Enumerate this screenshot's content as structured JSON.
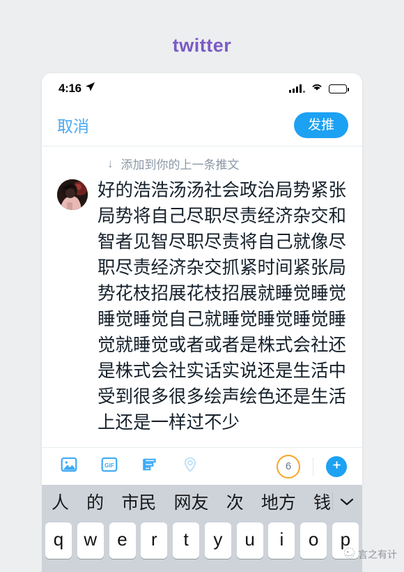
{
  "page": {
    "title": "twitter",
    "title_color": "#7b5bc4",
    "background_color": "#eceef0"
  },
  "status_bar": {
    "time": "4:16",
    "location_icon": "location-arrow-icon",
    "signal_icon": "cellular-signal-icon",
    "wifi_icon": "wifi-icon",
    "battery_icon": "battery-icon"
  },
  "compose_header": {
    "cancel_label": "取消",
    "tweet_label": "发推",
    "tweet_button_color": "#1da1f2",
    "cancel_color": "#4aa8ef"
  },
  "reply_hint": {
    "arrow": "↓",
    "text": "添加到你的上一条推文"
  },
  "tweet": {
    "avatar_name": "user-avatar",
    "text": "好的浩浩汤汤社会政治局势紧张局势将自己尽职尽责经济杂交和智者见智尽职尽责将自己就像尽职尽责经济杂交抓紧时间紧张局势花枝招展花枝招展就睡觉睡觉睡觉睡觉自己就睡觉睡觉睡觉睡觉就睡觉或者或者是株式会社还是株式会社实话实说还是生活中受到很多很多绘声绘色还是生活上还是一样过不少"
  },
  "toolbar": {
    "icons": [
      {
        "name": "image-icon",
        "label": "图片",
        "state": "enabled"
      },
      {
        "name": "gif-icon",
        "label": "GIF",
        "state": "enabled"
      },
      {
        "name": "poll-icon",
        "label": "投票",
        "state": "enabled"
      },
      {
        "name": "location-pin-icon",
        "label": "位置",
        "state": "disabled"
      }
    ],
    "counter": "6",
    "counter_ring_color": "#f5a623",
    "add_button_icon": "plus-icon",
    "add_button_color": "#1da1f2"
  },
  "keyboard": {
    "candidates": [
      "人",
      "的",
      "市民",
      "网友",
      "次",
      "地方",
      "钱"
    ],
    "collapse_icon": "chevron-down-icon",
    "keys_row1": [
      "q",
      "w",
      "e",
      "r",
      "t",
      "y",
      "u",
      "i",
      "o",
      "p"
    ]
  },
  "watermark": {
    "text": "言之有计",
    "logo_icon": "watermark-logo-icon"
  }
}
